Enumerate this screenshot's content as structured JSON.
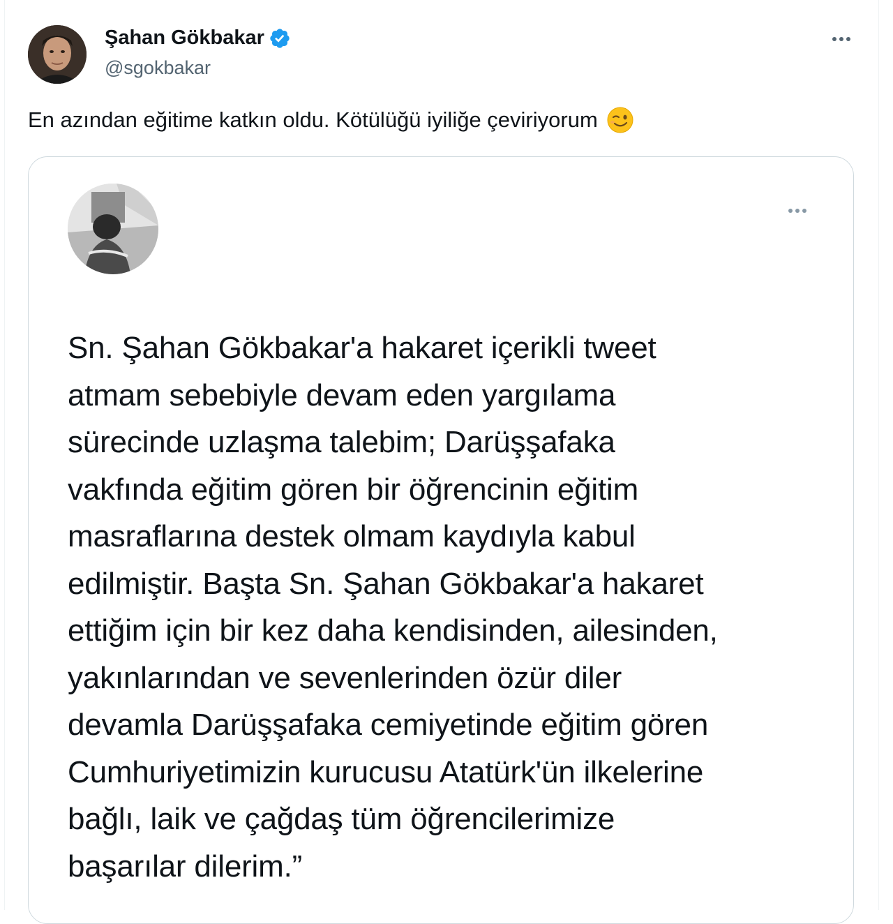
{
  "tweet": {
    "author": {
      "name": "Şahan Gökbakar",
      "handle": "@sgokbakar",
      "verified": true,
      "avatar_icon": "profile-photo"
    },
    "text": "En azından eğitime katkın oldu. Kötülüğü iyiliğe çeviriyorum",
    "emoji": "winking-face-emoji",
    "more_icon": "more-horizontal-icon",
    "quoted": {
      "avatar_icon": "blurred-profile-photo",
      "more_icon": "more-horizontal-icon",
      "lines": [
        "Sn. Şahan Gökbakar'a hakaret içerikli tweet",
        "atmam sebebiyle devam eden yargılama",
        "sürecinde uzlaşma talebim; Darüşşafaka",
        "vakfında eğitim gören bir öğrencinin eğitim",
        "masraflarına destek olmam kaydıyla kabul",
        "edilmiştir. Başta Sn. Şahan Gökbakar'a hakaret",
        "ettiğim için bir kez daha kendisinden, ailesinden,",
        "yakınlarından ve sevenlerinden özür diler",
        "devamla Darüşşafaka cemiyetinde eğitim gören",
        "Cumhuriyetimizin kurucusu Atatürk'ün ilkelerine",
        "bağlı, laik ve çağdaş tüm öğrencilerimize",
        "başarılar dilerim.”"
      ]
    }
  },
  "colors": {
    "text_primary": "#0f1419",
    "text_secondary": "#536471",
    "verified_blue": "#1d9bf0",
    "border": "#cfd9de"
  }
}
